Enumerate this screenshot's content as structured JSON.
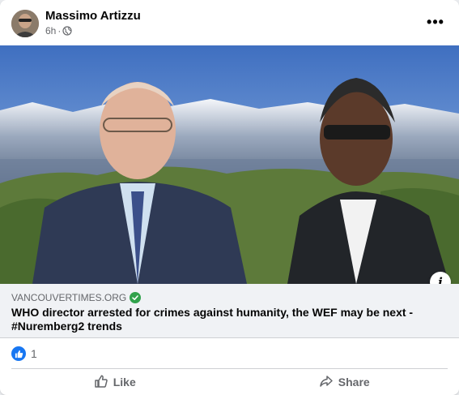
{
  "post": {
    "author": "Massimo Artizzu",
    "time": "6h",
    "separator": "·",
    "more_label": "•••",
    "audience_icon": "globe-icon"
  },
  "link": {
    "domain": "VANCOUVERTIMES.ORG",
    "headline": "WHO director arrested for crimes against humanity, the WEF may be next - #Nuremberg2 trends",
    "info_label": "i"
  },
  "reactions": {
    "count": "1",
    "icon": "thumbs-up-icon"
  },
  "actions": {
    "like_label": "Like",
    "share_label": "Share"
  },
  "colors": {
    "accent": "#1877f2",
    "verified": "#31a24c",
    "secondary_text": "#65676b",
    "preview_bg": "#f0f2f5"
  }
}
